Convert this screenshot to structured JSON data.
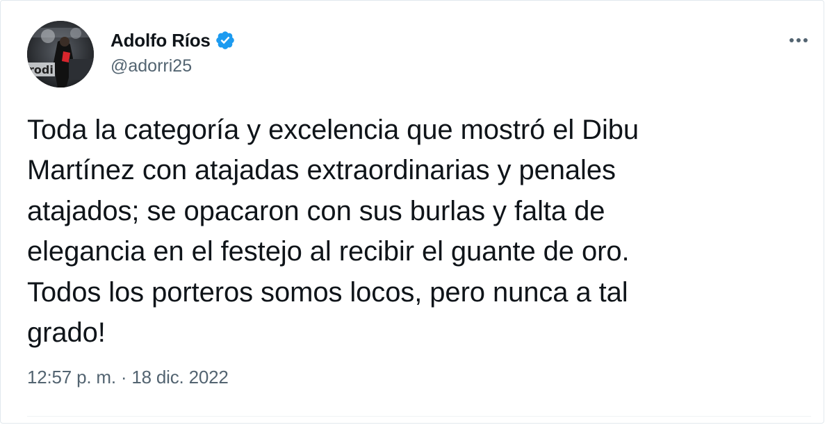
{
  "tweet": {
    "author": {
      "display_name": "Adolfo Ríos",
      "handle": "@adorri25",
      "verified": true,
      "verified_icon": "verified-badge-icon",
      "verified_color": "#1d9bf0"
    },
    "text": "Toda la categoría y excelencia que mostró el Dibu\nMartínez con atajadas extraordinarias y penales\natajados; se opacaron con sus burlas y falta de\nelegancia en el festejo al recibir el guante de oro.\nTodos los porteros somos locos, pero nunca a tal\ngrado!",
    "timestamp": "12:57 p. m. · 18 dic. 2022",
    "more_icon": "more-options-icon"
  },
  "colors": {
    "text_primary": "#0f1419",
    "text_secondary": "#536471",
    "border": "#e1e8ed"
  }
}
